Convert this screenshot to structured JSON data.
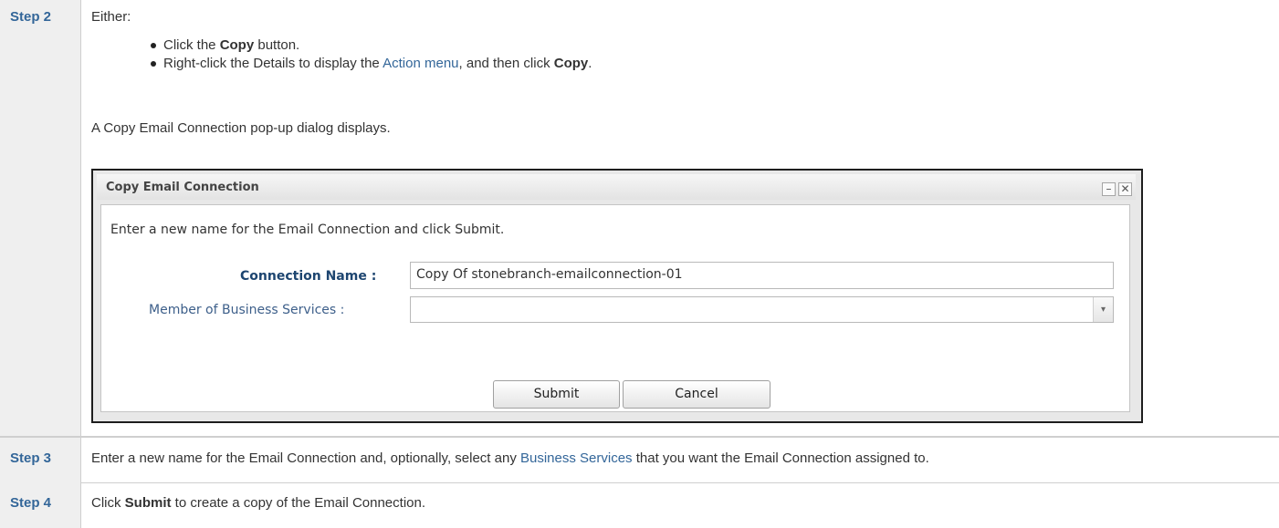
{
  "steps": {
    "step2": {
      "label": "Step 2",
      "intro": "Either:",
      "bullet1": {
        "pre": "Click the ",
        "bold": "Copy",
        "post": " button."
      },
      "bullet2": {
        "pre": "Right-click the Details to display the ",
        "link": "Action menu",
        "mid": ", and then click ",
        "bold": "Copy",
        "post": "."
      },
      "result": "A Copy Email Connection pop-up dialog displays."
    },
    "step3": {
      "label": "Step 3",
      "pre": "Enter a new name for the Email Connection and, optionally, select any ",
      "link": "Business Services",
      "post": " that you want the Email Connection assigned to."
    },
    "step4": {
      "label": "Step 4",
      "pre": "Click ",
      "bold": "Submit",
      "post": " to create a copy of the Email Connection."
    }
  },
  "dialog": {
    "title": "Copy Email Connection",
    "minimize_glyph": "–",
    "close_glyph": "✕",
    "instruction": "Enter a new name for the Email Connection and click Submit.",
    "name_label": "Connection Name :",
    "name_value": "Copy Of stonebranch-emailconnection-01",
    "services_label": "Member of Business Services :",
    "services_value": "",
    "dropdown_glyph": "▾",
    "submit_label": "Submit",
    "cancel_label": "Cancel"
  }
}
